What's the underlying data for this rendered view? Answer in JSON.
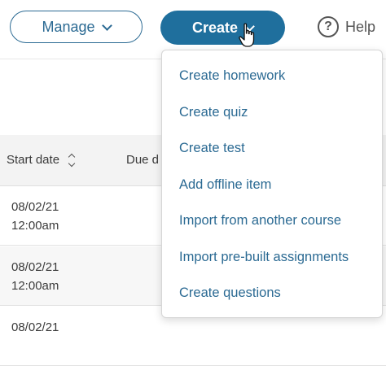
{
  "toolbar": {
    "manage_label": "Manage",
    "create_label": "Create",
    "help_label": "Help",
    "help_glyph": "?"
  },
  "table": {
    "headers": {
      "start_date": "Start date",
      "due_date": "Due d"
    },
    "rows": [
      {
        "start_date": "08/02/21",
        "start_time": "12:00am"
      },
      {
        "start_date": "08/02/21",
        "start_time": "12:00am"
      },
      {
        "start_date": "08/02/21",
        "start_time": ""
      }
    ]
  },
  "create_menu": {
    "items": [
      "Create homework",
      "Create quiz",
      "Create test",
      "Add offline item",
      "Import from another course",
      "Import pre-built assignments",
      "Create questions"
    ]
  },
  "colors": {
    "accent": "#1f6f9d",
    "link": "#2b6a93",
    "header_bg": "#f3f3f3"
  },
  "icons": {
    "manage_chevron": "chevron-down-icon",
    "create_chevron": "chevron-down-icon",
    "help": "help-circle-icon",
    "sort": "sort-icon",
    "cursor": "hand-pointer-icon"
  }
}
